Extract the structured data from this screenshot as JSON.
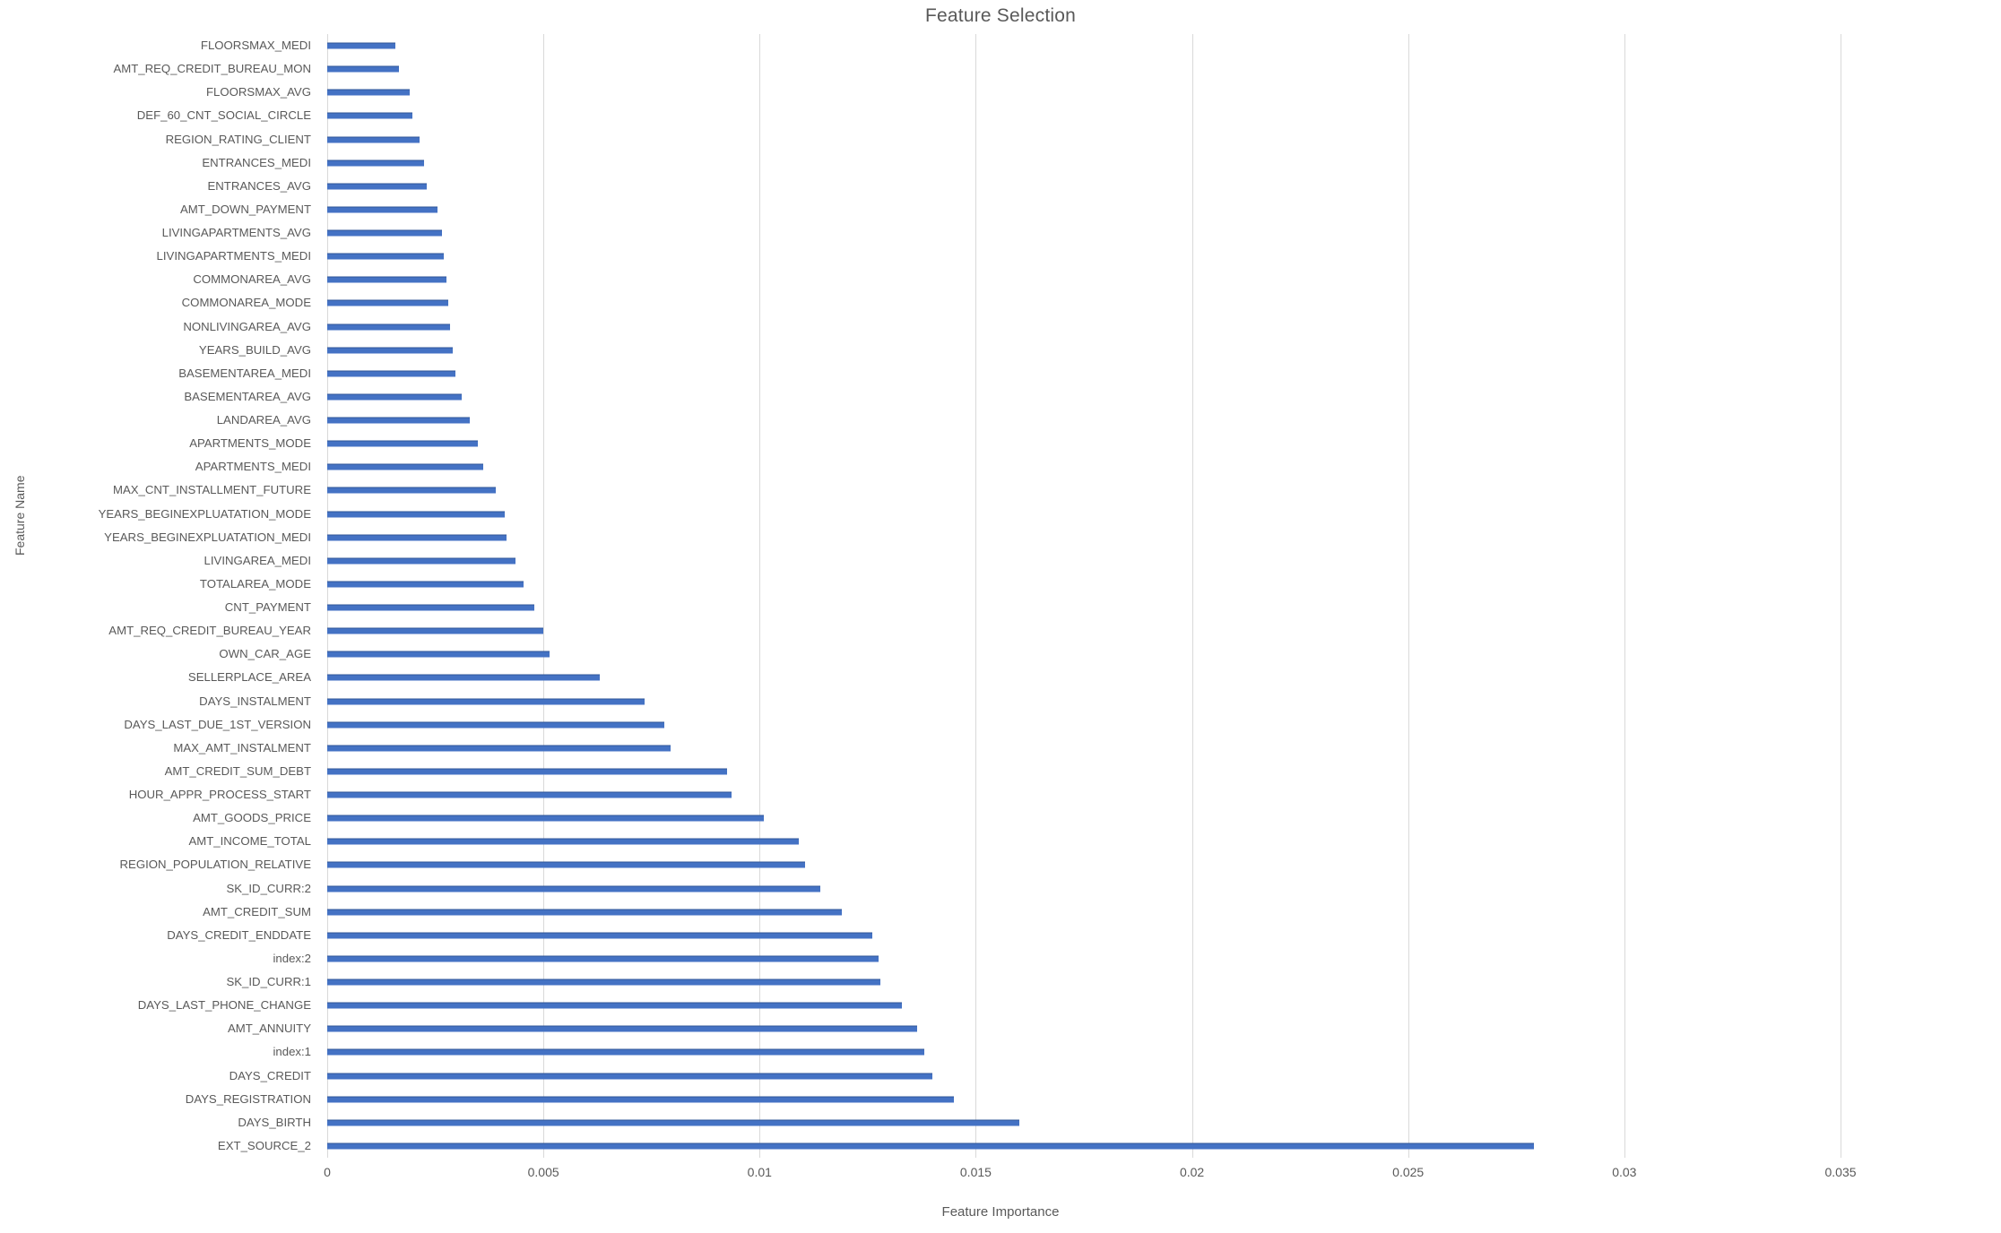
{
  "chart_data": {
    "type": "bar",
    "orientation": "horizontal",
    "title": "Feature Selection",
    "xlabel": "Feature Importance",
    "ylabel": "Feature Name",
    "xlim": [
      0,
      0.035
    ],
    "xticks": [
      "0",
      "0.005",
      "0.01",
      "0.015",
      "0.02",
      "0.025",
      "0.03",
      "0.035"
    ],
    "xtick_values": [
      0,
      0.005,
      0.01,
      0.015,
      0.02,
      0.025,
      0.03,
      0.035
    ],
    "grid": "vertical",
    "legend": "none",
    "bar_color": "#4472c4",
    "categories": [
      "FLOORSMAX_MEDI",
      "AMT_REQ_CREDIT_BUREAU_MON",
      "FLOORSMAX_AVG",
      "DEF_60_CNT_SOCIAL_CIRCLE",
      "REGION_RATING_CLIENT",
      "ENTRANCES_MEDI",
      "ENTRANCES_AVG",
      "AMT_DOWN_PAYMENT",
      "LIVINGAPARTMENTS_AVG",
      "LIVINGAPARTMENTS_MEDI",
      "COMMONAREA_AVG",
      "COMMONAREA_MODE",
      "NONLIVINGAREA_AVG",
      "YEARS_BUILD_AVG",
      "BASEMENTAREA_MEDI",
      "BASEMENTAREA_AVG",
      "LANDAREA_AVG",
      "APARTMENTS_MODE",
      "APARTMENTS_MEDI",
      "MAX_CNT_INSTALLMENT_FUTURE",
      "YEARS_BEGINEXPLUATATION_MODE",
      "YEARS_BEGINEXPLUATATION_MEDI",
      "LIVINGAREA_MEDI",
      "TOTALAREA_MODE",
      "CNT_PAYMENT",
      "AMT_REQ_CREDIT_BUREAU_YEAR",
      "OWN_CAR_AGE",
      "SELLERPLACE_AREA",
      "DAYS_INSTALMENT",
      "DAYS_LAST_DUE_1ST_VERSION",
      "MAX_AMT_INSTALMENT",
      "AMT_CREDIT_SUM_DEBT",
      "HOUR_APPR_PROCESS_START",
      "AMT_GOODS_PRICE",
      "AMT_INCOME_TOTAL",
      "REGION_POPULATION_RELATIVE",
      "SK_ID_CURR:2",
      "AMT_CREDIT_SUM",
      "DAYS_CREDIT_ENDDATE",
      "index:2",
      "SK_ID_CURR:1",
      "DAYS_LAST_PHONE_CHANGE",
      "AMT_ANNUITY",
      "index:1",
      "DAYS_CREDIT",
      "DAYS_REGISTRATION",
      "DAYS_BIRTH",
      "EXT_SOURCE_2"
    ],
    "values": [
      0.00158,
      0.00165,
      0.0019,
      0.00196,
      0.00214,
      0.00224,
      0.00231,
      0.00255,
      0.00265,
      0.0027,
      0.00275,
      0.00279,
      0.00285,
      0.0029,
      0.00297,
      0.00312,
      0.0033,
      0.00348,
      0.0036,
      0.0039,
      0.0041,
      0.00415,
      0.00435,
      0.00455,
      0.0048,
      0.005,
      0.00515,
      0.0063,
      0.00735,
      0.0078,
      0.00795,
      0.00925,
      0.00935,
      0.0101,
      0.0109,
      0.01105,
      0.0114,
      0.0119,
      0.0126,
      0.01275,
      0.0128,
      0.0133,
      0.01365,
      0.0138,
      0.014,
      0.0145,
      0.016,
      0.0279
    ]
  }
}
